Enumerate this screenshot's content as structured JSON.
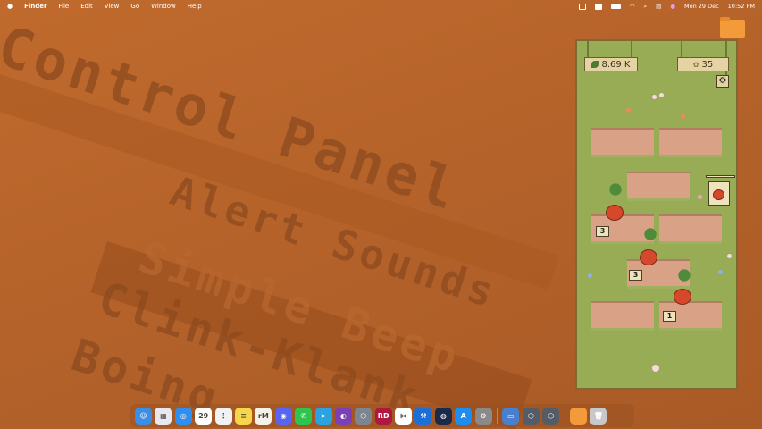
{
  "wallpaper": {
    "lines": [
      "Control Panel",
      "Alert Sounds",
      "Simple Beep",
      "Clink-Klank",
      "Boing"
    ]
  },
  "menubar": {
    "apple": "",
    "items": [
      "Finder",
      "File",
      "Edit",
      "View",
      "Go",
      "Window",
      "Help"
    ],
    "status": {
      "date": "Mon 29 Dec",
      "time": "10:52 PM"
    },
    "icons": [
      "screen-record-icon",
      "input-a-icon",
      "battery-icon",
      "wifi-icon",
      "search-icon",
      "control-center-icon",
      "siri-icon"
    ]
  },
  "game": {
    "currency": "8.69 K",
    "seeds": "35",
    "harvest_counts": [
      "3",
      "3",
      "1"
    ],
    "accent_colors": {
      "grass": "#98ac55",
      "soil": "#d9a287",
      "tomato": "#d6482c"
    }
  },
  "dock": {
    "apps": [
      {
        "name": "Finder",
        "color": "#3a8ee6",
        "glyph": "☺"
      },
      {
        "name": "Launchpad",
        "color": "#e8e8ee",
        "glyph": "▦"
      },
      {
        "name": "Safari",
        "color": "#2f8ff0",
        "glyph": "◎"
      },
      {
        "name": "Calendar",
        "color": "#ffffff",
        "glyph": "29"
      },
      {
        "name": "Reminders",
        "color": "#f2f2f2",
        "glyph": "⋮"
      },
      {
        "name": "Notes",
        "color": "#f7d64a",
        "glyph": "≡"
      },
      {
        "name": "Remember",
        "color": "#f5f1e8",
        "glyph": "rM"
      },
      {
        "name": "Discord",
        "color": "#5865f2",
        "glyph": "◉"
      },
      {
        "name": "WhatsApp",
        "color": "#2fc44d",
        "glyph": "✆"
      },
      {
        "name": "Telegram",
        "color": "#2aa3e0",
        "glyph": "➤"
      },
      {
        "name": "GitHub Desktop",
        "color": "#7b3fb8",
        "glyph": "◐"
      },
      {
        "name": "Unity Hub",
        "color": "#7d8591",
        "glyph": "⬡"
      },
      {
        "name": "Rider",
        "color": "#b0173e",
        "glyph": "RD"
      },
      {
        "name": "VS Code",
        "color": "#ffffff",
        "glyph": "⋈"
      },
      {
        "name": "Xcode",
        "color": "#1d6fd8",
        "glyph": "⚒"
      },
      {
        "name": "Steam",
        "color": "#1b2a4a",
        "glyph": "◍"
      },
      {
        "name": "App Store",
        "color": "#1f8cf0",
        "glyph": "A"
      },
      {
        "name": "System Settings",
        "color": "#8a8a8a",
        "glyph": "⚙"
      },
      {
        "name": "App",
        "color": "#4a7fd0",
        "glyph": "▭"
      },
      {
        "name": "Unity",
        "color": "#555c66",
        "glyph": "⬡"
      },
      {
        "name": "Unity",
        "color": "#555c66",
        "glyph": "⬡"
      }
    ],
    "stack": [
      {
        "name": "Folder",
        "color": "#f39a3a",
        "glyph": ""
      },
      {
        "name": "Trash",
        "color": "#c8c8c8",
        "glyph": "🗑"
      }
    ]
  }
}
